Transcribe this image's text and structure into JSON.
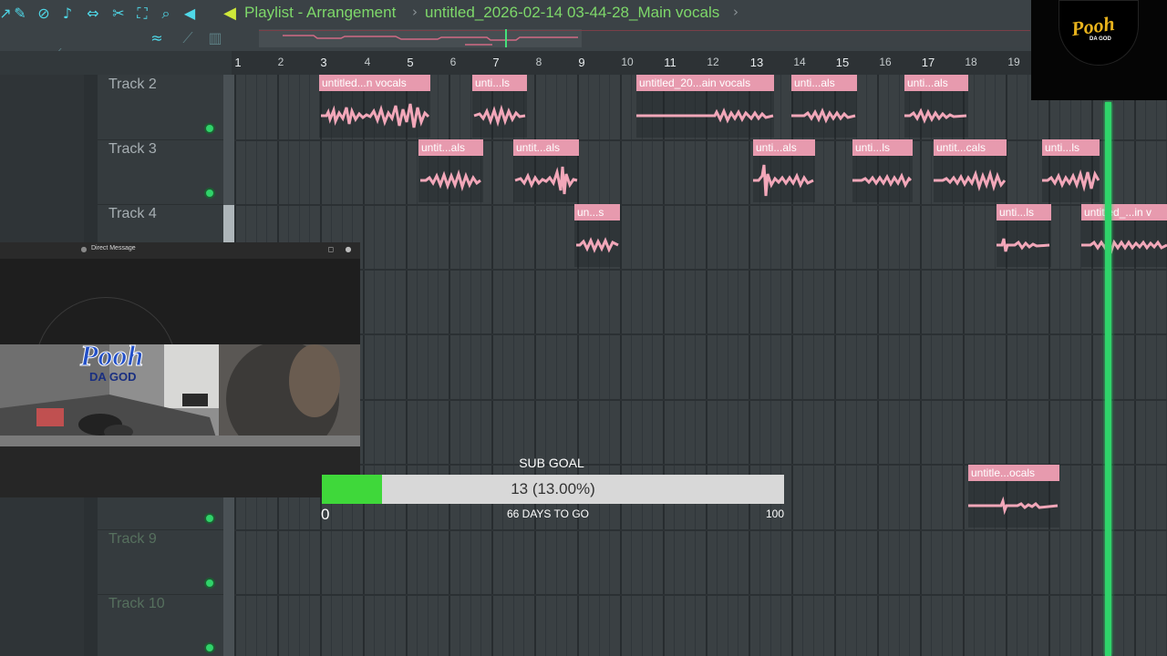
{
  "header": {
    "title": "Playlist - Arrangement",
    "separator": "›",
    "pattern": "untitled_2026-02-14 03-44-28_Main vocals"
  },
  "toolbar": {
    "icons": [
      "magnet-icon",
      "paint-icon",
      "delete-icon",
      "mute-icon",
      "slip-icon",
      "slice-icon",
      "select-icon",
      "zoom-icon",
      "playback-icon"
    ]
  },
  "ruler": {
    "bars": [
      "1",
      "2",
      "3",
      "4",
      "5",
      "6",
      "7",
      "8",
      "9",
      "10",
      "11",
      "12",
      "13",
      "14",
      "15",
      "16",
      "17",
      "18",
      "19"
    ]
  },
  "tracks": [
    {
      "name": "Track 2",
      "dim": false
    },
    {
      "name": "Track 3",
      "dim": false
    },
    {
      "name": "Track 4",
      "dim": false
    },
    {
      "name": "Track 9",
      "dim": true
    },
    {
      "name": "Track 10",
      "dim": true
    }
  ],
  "clips": {
    "t2": [
      "untitled...n vocals",
      "unti...ls",
      "untitled_20...ain vocals",
      "unti...als",
      "unti...als"
    ],
    "t3": [
      "untit...als",
      "untit...als",
      "unti...als",
      "unti...ls",
      "untit...cals",
      "unti...ls"
    ],
    "t4": [
      "un...s",
      "unti...ls",
      "untitled_...in v"
    ],
    "t8": [
      "untitle...ocals"
    ]
  },
  "chat_window": {
    "title": "Direct Message",
    "webcam_logo": "Pooh",
    "webcam_logo_sub": "DA GOD"
  },
  "sub_goal": {
    "label": "SUB GOAL",
    "current": 13,
    "progress_text": "13 (13.00%)",
    "fraction": 0.13,
    "min": "0",
    "max": "100",
    "days_left": "66 DAYS TO GO"
  },
  "logo": {
    "text": "Pooh",
    "sub": "DA GOD"
  },
  "colors": {
    "accent_green": "#2fd46a",
    "clip_pink": "#e79aae",
    "title_green": "#7ed86a"
  }
}
